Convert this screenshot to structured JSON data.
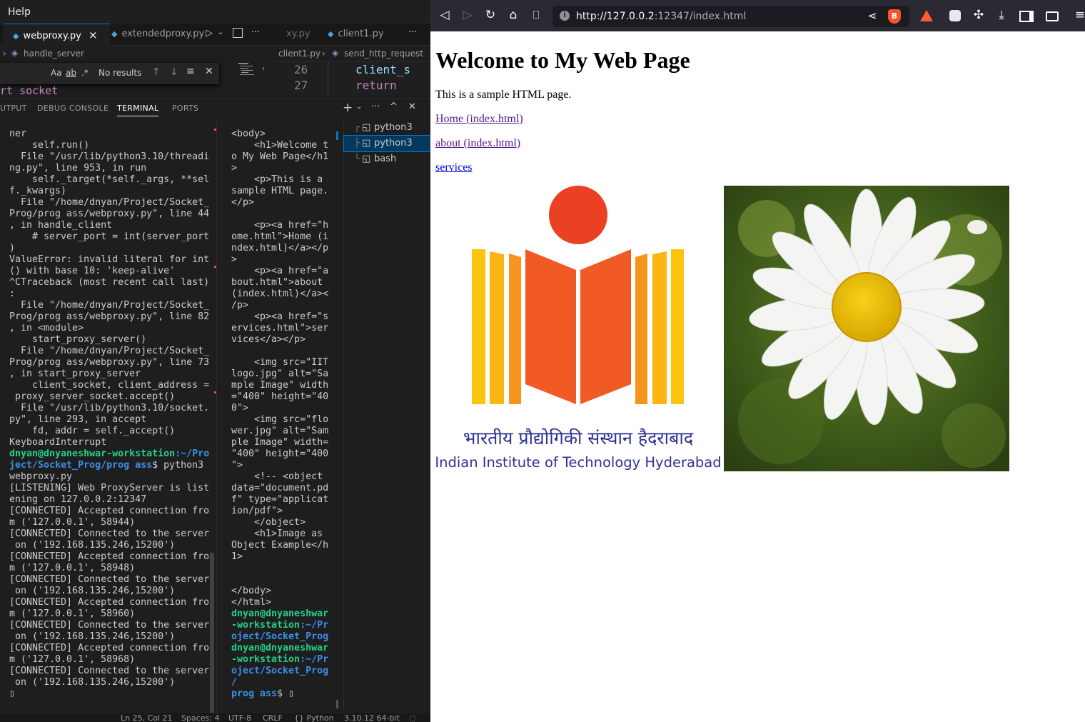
{
  "vscode": {
    "menu": {
      "help": "Help"
    },
    "tabs": [
      {
        "label": "webproxy.py",
        "close": "×",
        "active": true
      },
      {
        "label": "extendedproxy.py",
        "active": false
      },
      {
        "label": "xy.py",
        "active": false
      },
      {
        "label": "client1.py",
        "active": false
      }
    ],
    "breadcrumbs": {
      "left": "handle_server",
      "right_file": "client1.py",
      "right_symbol": "send_http_request"
    },
    "find": {
      "case_label": "Aa",
      "word_label": "ab",
      "regex_label": ".*",
      "result": "No results"
    },
    "editor_peek": "rt socket",
    "editor_right_lines": [
      {
        "num": "26",
        "code": "client_s"
      },
      {
        "num": "27",
        "code": "return "
      }
    ],
    "panel_tabs": [
      "UTPUT",
      "DEBUG CONSOLE",
      "TERMINAL",
      "PORTS"
    ],
    "terminal_left": [
      "ner",
      "    self.run()",
      "  File \"/usr/lib/python3.10/threadi",
      "ng.py\", line 953, in run",
      "    self._target(*self._args, **sel",
      "f._kwargs)",
      "  File \"/home/dnyan/Project/Socket_",
      "Prog/prog ass/webproxy.py\", line 44",
      ", in handle_client",
      "    # server_port = int(server_port",
      ")",
      "ValueError: invalid literal for int",
      "() with base 10: 'keep-alive'",
      "^CTraceback (most recent call last)",
      ":",
      "  File \"/home/dnyan/Project/Socket_",
      "Prog/prog ass/webproxy.py\", line 82",
      ", in <module>",
      "    start_proxy_server()",
      "  File \"/home/dnyan/Project/Socket_",
      "Prog/prog ass/webproxy.py\", line 73",
      ", in start_proxy_server",
      "    client_socket, client_address =",
      " proxy_server_socket.accept()",
      "  File \"/usr/lib/python3.10/socket.",
      "py\", line 293, in accept",
      "    fd, addr = self._accept()",
      "KeyboardInterrupt",
      ""
    ],
    "prompt_user": "dnyan@dnyaneshwar-workstation",
    "prompt_path_left_1": ":~/Pro",
    "prompt_path_left_2": "ject/Socket_Prog/prog ass",
    "prompt_cmd_left": "$ python3",
    "terminal_left_after": [
      "webproxy.py",
      "[LISTENING] Web ProxyServer is list",
      "ening on 127.0.0.2:12347",
      "[CONNECTED] Accepted connection fro",
      "m ('127.0.0.1', 58944)",
      "[CONNECTED] Connected to the server",
      " on ('192.168.135.246,15200')",
      "[CONNECTED] Accepted connection fro",
      "m ('127.0.0.1', 58948)",
      "[CONNECTED] Connected to the server",
      " on ('192.168.135.246,15200')",
      "[CONNECTED] Accepted connection fro",
      "m ('127.0.0.1', 58960)",
      "[CONNECTED] Connected to the server",
      " on ('192.168.135.246,15200')",
      "[CONNECTED] Accepted connection fro",
      "m ('127.0.0.1', 58968)",
      "[CONNECTED] Connected to the server",
      " on ('192.168.135.246,15200')",
      "▯"
    ],
    "terminal_mid": [
      "<body>",
      "    <h1>Welcome t",
      "o My Web Page</h1",
      ">",
      "    <p>This is a",
      "sample HTML page.",
      "</p>",
      "",
      "    <p><a href=\"h",
      "ome.html\">Home (i",
      "ndex.html)</a></p",
      ">",
      "    <p><a href=\"a",
      "bout.html\">about",
      "(index.html)</a><",
      "/p>",
      "    <p><a href=\"s",
      "ervices.html\">ser",
      "vices</a></p>",
      "",
      "    <img src=\"IIT",
      "logo.jpg\" alt=\"Sa",
      "mple Image\" width",
      "=\"400\" height=\"40",
      "0\">",
      "    <img src=\"flo",
      "wer.jpg\" alt=\"Sam",
      "ple Image\" width=",
      "\"400\" height=\"400",
      "\">",
      "    <!-- <object",
      "data=\"document.pd",
      "f\" type=\"applicat",
      "ion/pdf\">",
      "    </object>",
      "    <h1>Image as",
      "Object Example</h",
      "1>",
      "",
      "",
      "</body>",
      "</html>",
      ""
    ],
    "mid_prompt_1_user": "dnyan@dnyaneshwar",
    "mid_prompt_1_user2": "-workstation",
    "mid_prompt_1_path": ":~/Pr",
    "mid_prompt_1_path2": "oject/Socket_Prog",
    "mid_prompt_2_user": "dnyan@dnyaneshwar",
    "mid_prompt_2_user2": "-workstation",
    "mid_prompt_2_path": ":~/Pr",
    "mid_prompt_2_path2": "oject/Socket_Prog",
    "mid_prompt_2_path3": "/",
    "mid_prompt_last_path": "prog ass",
    "mid_prompt_last_cmd": "$ ▯",
    "terminal_list": [
      {
        "label": "python3",
        "selected": false
      },
      {
        "label": "python3",
        "selected": true
      },
      {
        "label": "bash",
        "selected": false
      }
    ],
    "status": {
      "position": "Ln 25, Col 21",
      "spaces": "Spaces: 4",
      "encoding": "UTF-8",
      "eol": "CRLF",
      "language": "{} Python",
      "interpreter": "3.10.12 64-bit"
    }
  },
  "browser": {
    "url_host": "http://127.0.0.2",
    "url_rest": ":12347/index.html",
    "page": {
      "heading": "Welcome to My Web Page",
      "intro": "This is a sample HTML page.",
      "link_home": "Home (index.html)",
      "link_about": "about (index.html)",
      "link_services": "services",
      "logo_hindi": "भारतीय प्रौद्योगिकी संस्थान हैदराबाद",
      "logo_english": "Indian Institute of Technology Hyderabad"
    }
  },
  "colors": {
    "vscode_bg": "#1e1e1e",
    "accent": "#0078d4",
    "term_green": "#23d18b",
    "term_blue": "#3b8eea",
    "browser_toolbar": "#2b2a33",
    "link_visited": "#551a8b",
    "link_unvisited": "#0000ee",
    "logo_red": "#ea4125",
    "logo_orange": "#f15a24",
    "logo_yellow": "#fbb614",
    "logo_text_blue": "#2e3192"
  }
}
